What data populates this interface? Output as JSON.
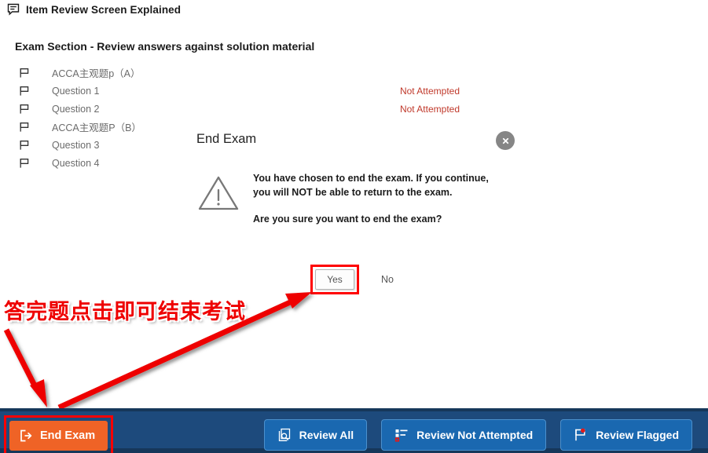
{
  "header": {
    "icon": "comment-bubble-icon",
    "title": "Item Review Screen Explained"
  },
  "section": {
    "title": "Exam Section - Review answers against solution material"
  },
  "question_list": {
    "flag_icon": "flag-outline-icon",
    "rows": [
      {
        "label": "ACCA主观题p（A）",
        "status": ""
      },
      {
        "label": "Question 1",
        "status": "Not Attempted"
      },
      {
        "label": "Question 2",
        "status": "Not Attempted"
      },
      {
        "label": "ACCA主观题P（B）",
        "status": ""
      },
      {
        "label": "Question 3",
        "status": ""
      },
      {
        "label": "Question 4",
        "status": ""
      }
    ]
  },
  "dialog": {
    "title": "End Exam",
    "close_icon": "close-icon",
    "warning_icon": "warning-triangle-icon",
    "message": "You have chosen to end the exam. If you continue, you will NOT be able to return to the exam.",
    "confirm_question": "Are you sure you want to end the exam?",
    "yes_label": "Yes",
    "no_label": "No"
  },
  "annotation": {
    "text": "答完题点击即可结束考试",
    "color": "#ee0000"
  },
  "toolbar": {
    "end_exam": {
      "label": "End Exam",
      "icon": "exit-arrow-icon",
      "color": "#ef6326"
    },
    "buttons": [
      {
        "label": "Review All",
        "icon": "documents-search-icon"
      },
      {
        "label": "Review Not Attempted",
        "icon": "list-unattempted-icon"
      },
      {
        "label": "Review Flagged",
        "icon": "flag-marked-icon"
      }
    ],
    "background_color": "#1d4a7c",
    "button_color": "#1a68b0"
  },
  "highlights": {
    "yes_button_box_color": "#ff0000",
    "end_exam_box_color": "#ff0000"
  }
}
